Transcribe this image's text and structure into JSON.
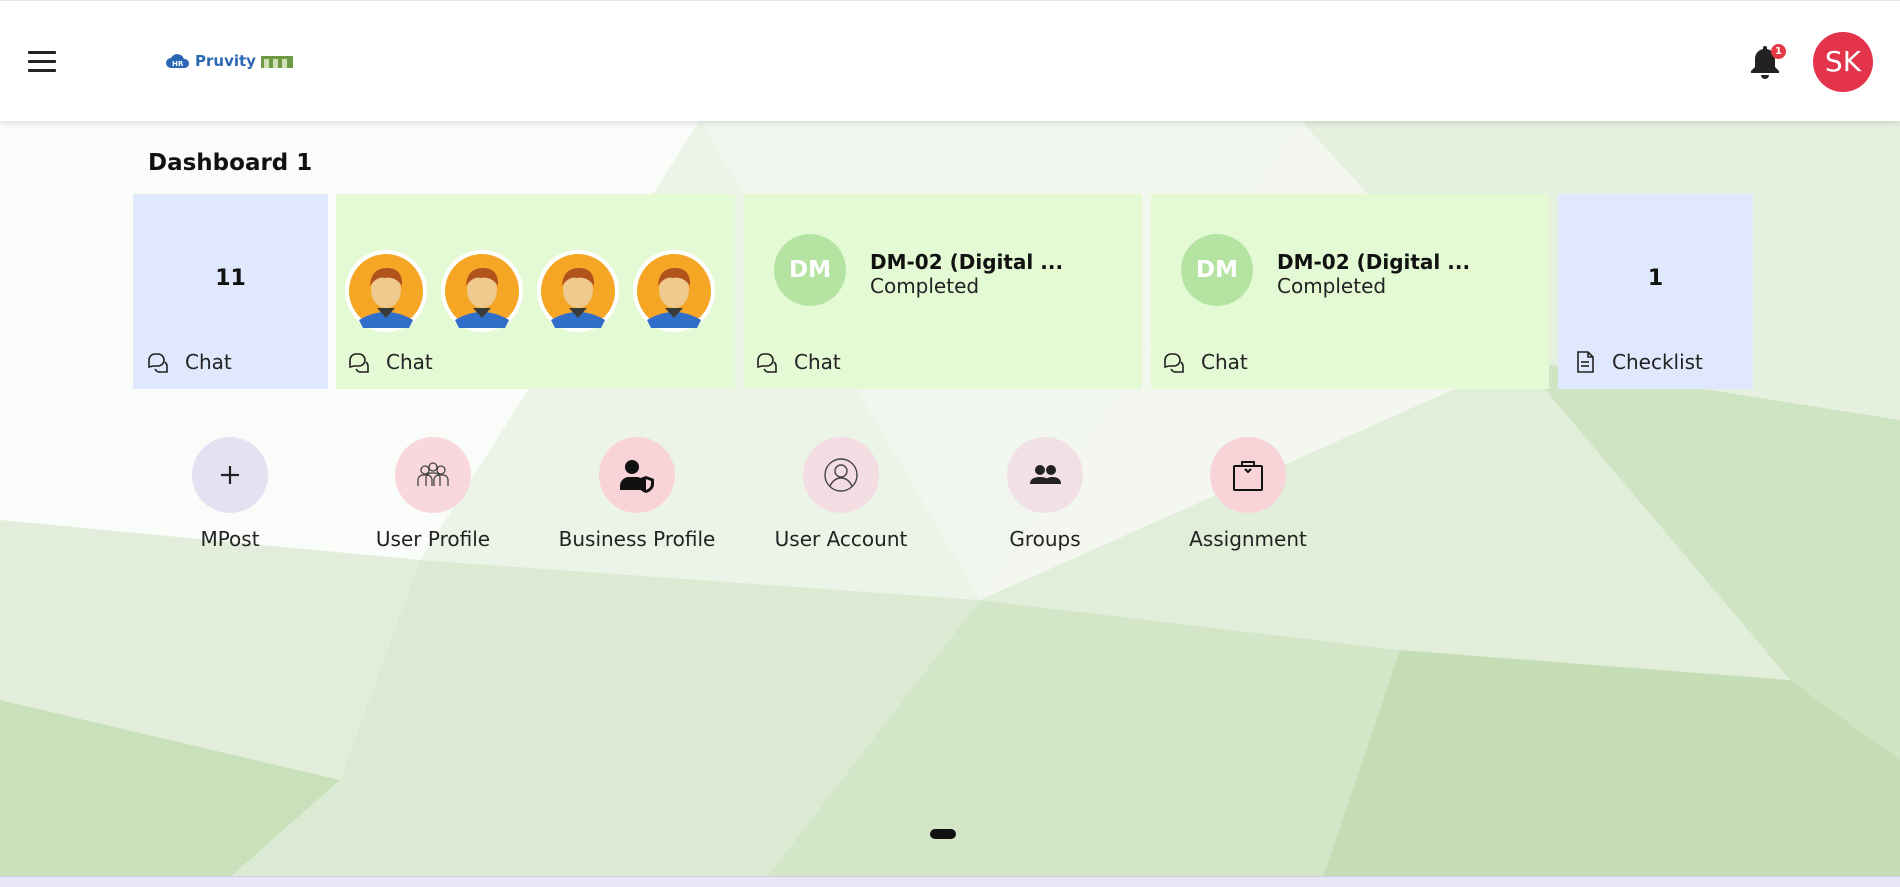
{
  "header": {
    "logo_text": "Pruvity",
    "logo_badge": "HR",
    "notification_count": "1",
    "user_initials": "SK"
  },
  "dashboard": {
    "title": "Dashboard 1"
  },
  "cards": [
    {
      "count": "11",
      "label": "Chat",
      "icon": "chat-icon"
    },
    {
      "label": "Chat",
      "icon": "chat-icon",
      "avatar_count": 4
    },
    {
      "badge": "DM",
      "title": "DM-02 (Digital ...",
      "status": "Completed",
      "label": "Chat",
      "icon": "chat-icon"
    },
    {
      "badge": "DM",
      "title": "DM-02 (Digital ...",
      "status": "Completed",
      "label": "Chat",
      "icon": "chat-icon"
    },
    {
      "count": "1",
      "label": "Checklist",
      "icon": "document-icon"
    }
  ],
  "shortcuts": [
    {
      "label": "MPost",
      "icon": "plus-icon",
      "color": "#e4e1f3"
    },
    {
      "label": "User Profile",
      "icon": "team-icon",
      "color": "#f8d8dc"
    },
    {
      "label": "Business Profile",
      "icon": "user-shield-icon",
      "color": "#f8d4d8"
    },
    {
      "label": "User Account",
      "icon": "user-circle-icon",
      "color": "#f3dce2"
    },
    {
      "label": "Groups",
      "icon": "group-icon",
      "color": "#f1e0e6"
    },
    {
      "label": "Assignment",
      "icon": "briefcase-icon",
      "color": "#f8d4d8"
    }
  ],
  "colors": {
    "card_blue": "#dfe8fd",
    "card_green": "#e3fad4",
    "avatar_red": "#e3344b",
    "dm_badge_green": "#b4e3a2"
  }
}
